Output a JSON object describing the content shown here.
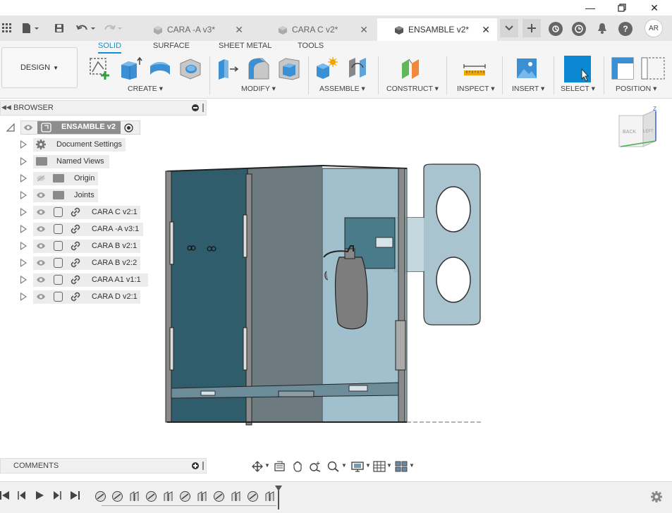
{
  "window": {
    "minimize_icon": "minimize-icon",
    "restore_icon": "restore-icon",
    "close_icon": "close-icon"
  },
  "tabs": [
    {
      "label": "CARA -A v3*",
      "active": false
    },
    {
      "label": "CARA C v2*",
      "active": false
    },
    {
      "label": "ENSAMBLE v2*",
      "active": true
    }
  ],
  "user": {
    "initials": "AR"
  },
  "ribbon": {
    "workspace": "DESIGN",
    "tabs": [
      "SOLID",
      "SURFACE",
      "SHEET METAL",
      "TOOLS"
    ],
    "groups": [
      "CREATE",
      "MODIFY",
      "ASSEMBLE",
      "CONSTRUCT",
      "INSPECT",
      "INSERT",
      "SELECT",
      "POSITION"
    ]
  },
  "browser": {
    "title": "BROWSER",
    "root": "ENSAMBLE v2",
    "items": [
      {
        "label": "Document Settings",
        "type": "settings"
      },
      {
        "label": "Named Views",
        "type": "folder"
      },
      {
        "label": "Origin",
        "type": "folder"
      },
      {
        "label": "Joints",
        "type": "folder"
      },
      {
        "label": "CARA C v2:1",
        "type": "component"
      },
      {
        "label": "CARA -A v3:1",
        "type": "component"
      },
      {
        "label": "CARA B v2:1",
        "type": "component"
      },
      {
        "label": "CARA B v2:2",
        "type": "component"
      },
      {
        "label": "CARA  A1 v1:1",
        "type": "component"
      },
      {
        "label": "CARA D v2:1",
        "type": "component"
      }
    ]
  },
  "comments": {
    "title": "COMMENTS"
  },
  "viewcube": {
    "back": "BACK",
    "left": "LEFT",
    "z": "Z"
  },
  "colors": {
    "accent": "#0696d7",
    "glass_dark": "#2f5d6b",
    "glass_light": "#8fb6c4",
    "select_fill": "#0a88d1"
  }
}
